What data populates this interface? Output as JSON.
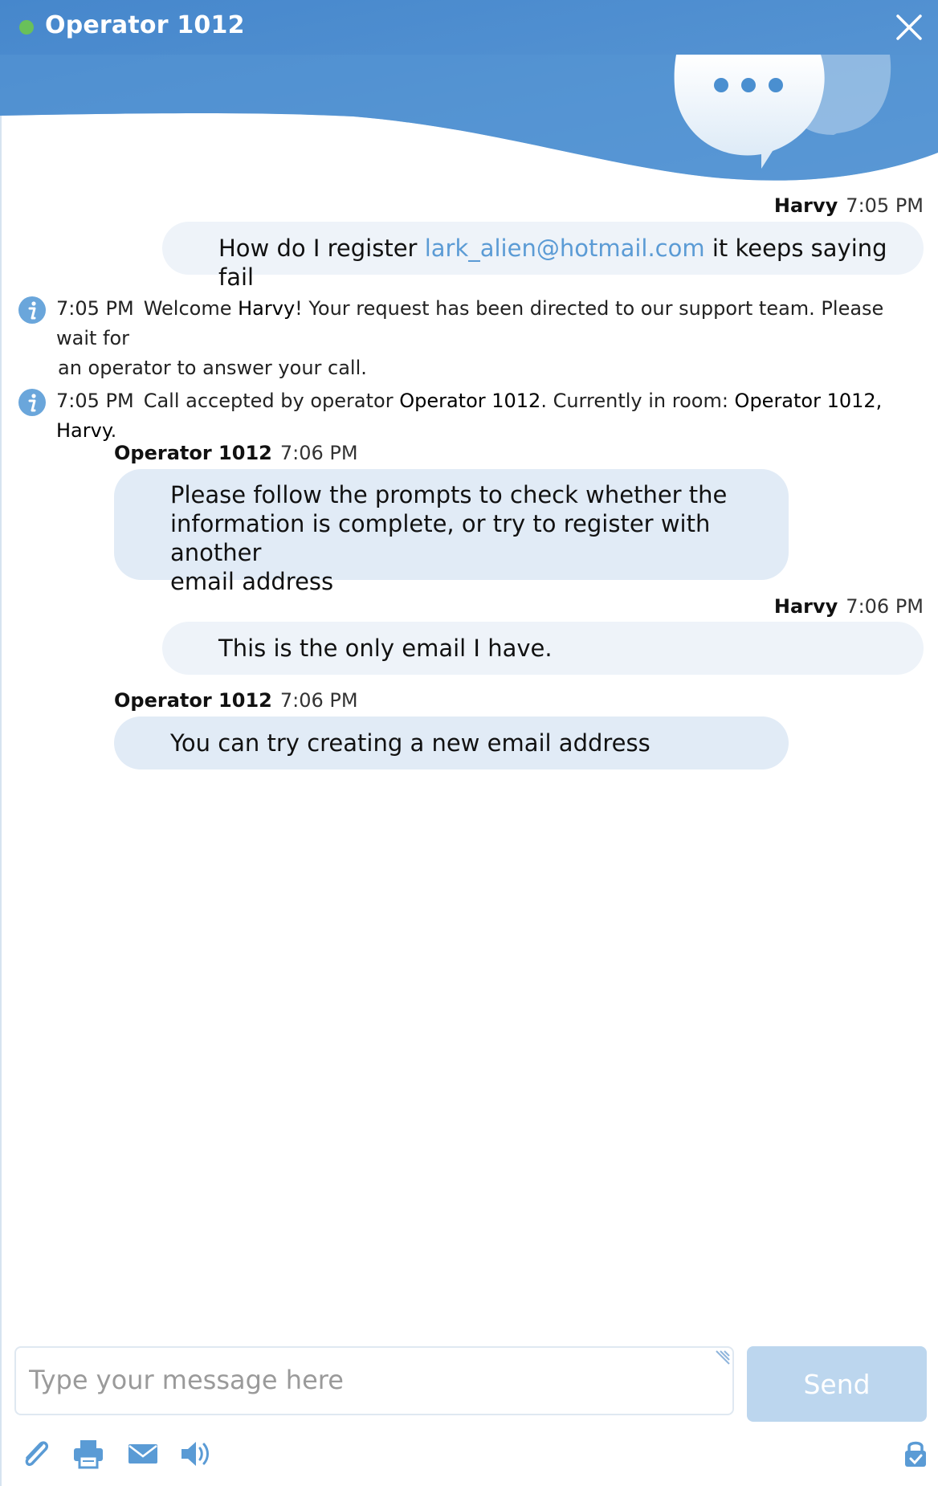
{
  "header": {
    "title": "Operator 1012",
    "status_color": "#69c05a",
    "brand_color": "#4a8fd0"
  },
  "messages": [
    {
      "author": "Harvy",
      "time": "7:05 PM",
      "text_before": "How do I register ",
      "link": "lark_alien@hotmail.com",
      "text_after": " it keeps saying fail"
    },
    {
      "author": "Operator 1012",
      "time": "7:06 PM",
      "lines": [
        "Please follow the prompts to check whether the",
        "information is complete, or try to register with another",
        "email address"
      ]
    },
    {
      "author": "Harvy",
      "time": "7:06 PM",
      "text": "This is the only email I have."
    },
    {
      "author": "Operator 1012",
      "time": "7:06 PM",
      "text": "You can try creating a new email address"
    }
  ],
  "system_messages": [
    {
      "time": "7:05 PM",
      "line1_a": "Welcome ",
      "line1_name": "Harvy",
      "line1_b": "! Your request has been directed to our support team. Please wait for",
      "line2": "an operator to answer your call."
    },
    {
      "time": "7:05 PM",
      "a": "Call accepted by operator ",
      "op": "Operator 1012",
      "b": ". Currently in room: ",
      "room": "Operator 1012, Harvy",
      "c": "."
    }
  ],
  "composer": {
    "placeholder": "Type your message here",
    "send_label": "Send"
  },
  "toolbar": {
    "icons": [
      "paperclip-icon",
      "printer-icon",
      "mail-icon",
      "speaker-icon",
      "lock-icon"
    ]
  }
}
